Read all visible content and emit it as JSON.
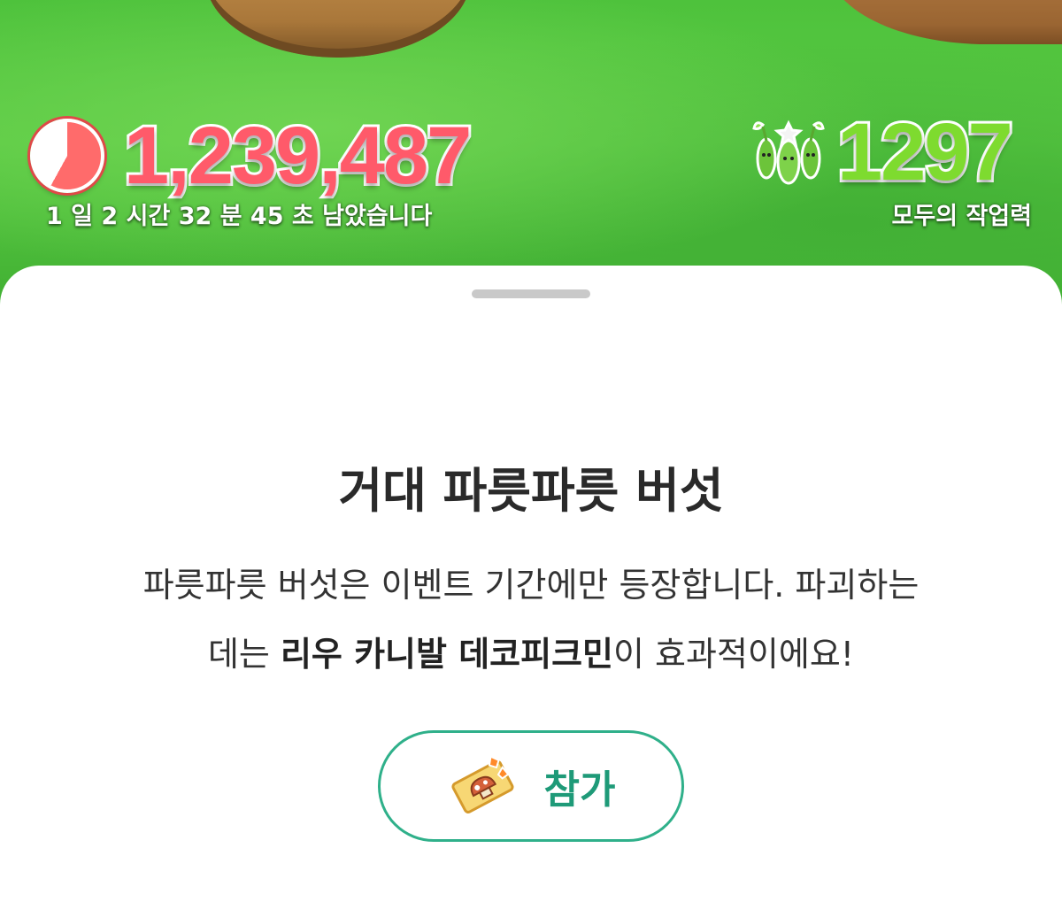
{
  "hud": {
    "score": "1,239,487",
    "time_remaining": "1 일 2 시간 32 분 45 초 남았습니다",
    "workforce": "1297",
    "workforce_label": "모두의 작업력",
    "timer_icon": "pie-timer-icon",
    "pikmin_icon": "pikmin-trio-icon"
  },
  "sheet": {
    "title": "거대 파릇파릇 버섯",
    "description_line1": "파릇파릇 버섯은 이벤트 기간에만 등장합니다. 파괴하는",
    "description_line2_prefix": "데는 ",
    "description_line2_bold": "리우 카니발 데코피크민",
    "description_line2_suffix": "이 효과적이에요!",
    "join_button_label": "참가",
    "ticket_icon": "mushroom-ticket-icon"
  },
  "colors": {
    "accent": "#2fb08a",
    "score": "#ff5a6a",
    "workforce": "#7edb2f"
  }
}
